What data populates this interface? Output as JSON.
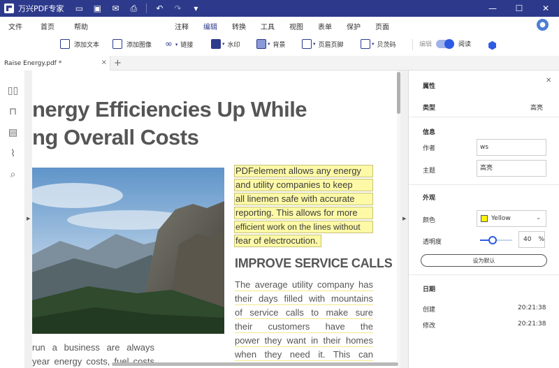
{
  "app": {
    "title": "万兴PDF专家",
    "window_controls": {
      "minimize": "—",
      "maximize": "☐",
      "close": "✕"
    }
  },
  "menu": {
    "left": [
      "文件",
      "首页",
      "帮助"
    ],
    "center": [
      "注释",
      "编辑",
      "转换",
      "工具",
      "视图",
      "表单",
      "保护",
      "页面"
    ],
    "active": "编辑"
  },
  "toolbar": {
    "add_text": "添加文本",
    "add_image": "添加图像",
    "link": "链接",
    "watermark": "水印",
    "background": "背景",
    "header_footer": "页眉页脚",
    "bates": "贝茨码",
    "edit_mode": "编辑",
    "read_mode": "阅读"
  },
  "tab": {
    "label": "Raise Energy.pdf *",
    "close": "×",
    "plus": "+"
  },
  "document": {
    "heading_line1": "nergy Efficiencies Up While",
    "heading_line2": "ng Overall Costs",
    "highlighted_lines": [
      "PDFelement allows any energy",
      "and utility companies to keep",
      "all linemen safe with accurate",
      "reporting. This allows for more",
      "efficient work on the lines without",
      "fear of electrocution."
    ],
    "subheading": "IMPROVE SERVICE CALLS",
    "underlined_lines": [
      "The average utility company has",
      "their days filled with mountains",
      "of service calls to make sure",
      "their customers have the",
      "power they want in their homes",
      "when they need it. This can"
    ],
    "left_lines": [
      "run a business are always",
      "year energy costs, fuel costs"
    ]
  },
  "properties": {
    "title": "属性",
    "type_label": "类型",
    "type_value": "高亮",
    "info_label": "信息",
    "author_label": "作者",
    "author_value": "ws",
    "subject_label": "主题",
    "subject_value": "高亮",
    "appearance_label": "外观",
    "color_label": "颜色",
    "color_value": "Yellow",
    "color_hex": "#fff200",
    "opacity_label": "透明度",
    "opacity_value": "40",
    "opacity_unit": "%",
    "opacity_fraction": 0.4,
    "default_button": "设为默认",
    "date_label": "日期",
    "created_label": "创建",
    "created_value": "20:21:38",
    "modified_label": "修改",
    "modified_value": "20:21:38"
  }
}
